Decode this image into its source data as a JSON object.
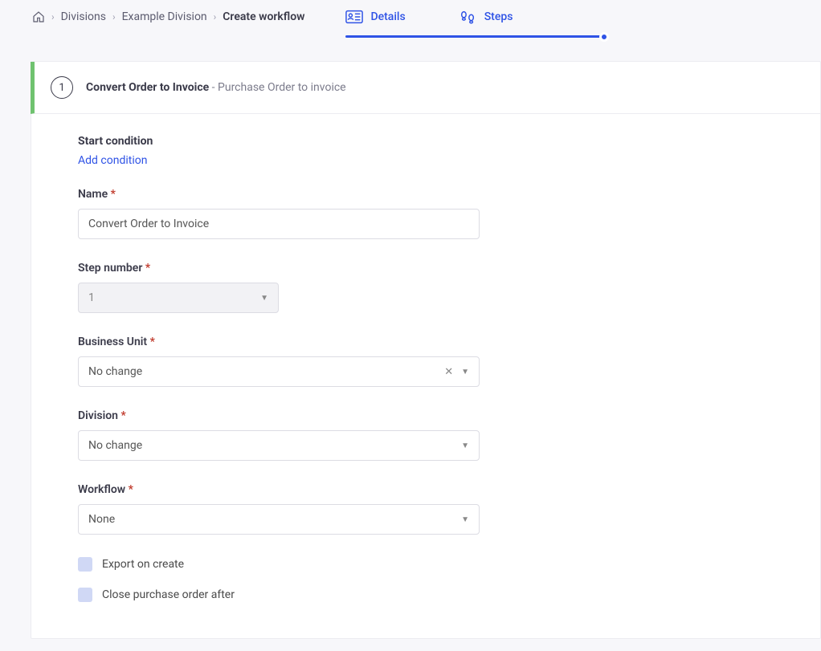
{
  "breadcrumbs": {
    "home": "Home",
    "divisions": "Divisions",
    "division_name": "Example Division",
    "current": "Create workflow"
  },
  "tabs": {
    "details": "Details",
    "steps": "Steps"
  },
  "step_header": {
    "number": "1",
    "title": "Convert Order to Invoice",
    "subtitle": "Purchase Order to invoice"
  },
  "form": {
    "start_condition_label": "Start condition",
    "add_condition": "Add condition",
    "name_label": "Name",
    "name_value": "Convert Order to Invoice",
    "step_number_label": "Step number",
    "step_number_value": "1",
    "business_unit_label": "Business Unit",
    "business_unit_value": "No change",
    "division_label": "Division",
    "division_value": "No change",
    "workflow_label": "Workflow",
    "workflow_value": "None",
    "export_label": "Export on create",
    "close_po_label": "Close purchase order after"
  }
}
